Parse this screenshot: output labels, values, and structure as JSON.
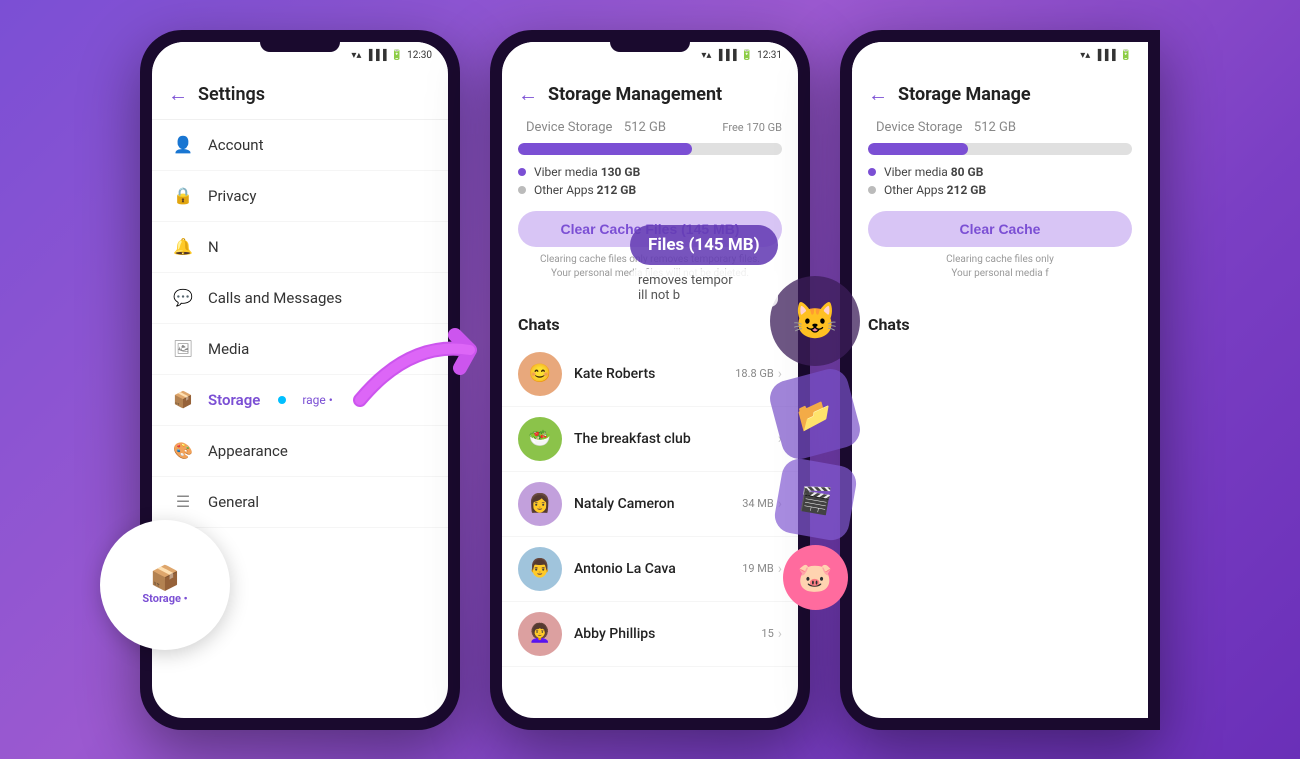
{
  "background": "#8B5CF6",
  "phone1": {
    "status_time": "12:30",
    "header": {
      "back_label": "←",
      "title": "Settings"
    },
    "menu_items": [
      {
        "icon": "👤",
        "label": "Account"
      },
      {
        "icon": "🔒",
        "label": "Privacy"
      },
      {
        "icon": "🔔",
        "label": "Notifications"
      },
      {
        "icon": "💬",
        "label": "Calls and Messages"
      },
      {
        "icon": "🖼",
        "label": "Media"
      },
      {
        "icon": "📦",
        "label": "Storage",
        "active": true,
        "dot": true
      },
      {
        "icon": "🎨",
        "label": "Appearance"
      },
      {
        "icon": "⚙",
        "label": "General"
      }
    ]
  },
  "phone2": {
    "status_time": "12:31",
    "header": {
      "back_label": "←",
      "title": "Storage Management"
    },
    "device_storage": {
      "label": "Device Storage",
      "total": "512 GB",
      "free_label": "Free",
      "free": "170 GB",
      "fill_percent": 66
    },
    "legend": [
      {
        "color": "purple",
        "label": "Viber media",
        "value": "130 GB"
      },
      {
        "color": "gray",
        "label": "Other Apps",
        "value": "212 GB"
      }
    ],
    "clear_cache_btn": "Clear Cache Files (145 MB)",
    "cache_note_line1": "Clearing cache files only removes temporary files.",
    "cache_note_line2": "Your personal media files will not be deleted.",
    "chats_header": "Chats",
    "chats": [
      {
        "name": "Kate Roberts",
        "size": "18.8 GB",
        "avatar_color": "#E8A87C",
        "emoji": "😊"
      },
      {
        "name": "The breakfast club",
        "size": "",
        "avatar_color": "#8BC34A",
        "emoji": "🥗"
      },
      {
        "name": "Nataly Cameron",
        "size": "34 MB",
        "avatar_color": "#C2A0DC",
        "emoji": "👩"
      },
      {
        "name": "Antonio La Cava",
        "size": "19 MB",
        "avatar_color": "#A0C4DC",
        "emoji": "👨"
      },
      {
        "name": "Abby Phillips",
        "size": "15",
        "avatar_color": "#DCA0A0",
        "emoji": "👩‍🦱"
      }
    ]
  },
  "overlay_bubble": "Files (145 MB)",
  "overlay_subtext": "removes tempor",
  "overlay_subtext2": "ill not b",
  "phone3": {
    "header": {
      "back_label": "←",
      "title": "Storage Manage"
    },
    "device_storage": {
      "label": "Device Storage",
      "total": "512 GB",
      "fill_percent": 38
    },
    "legend": [
      {
        "color": "purple",
        "label": "Viber media",
        "value": "80 GB"
      },
      {
        "color": "gray",
        "label": "Other Apps",
        "value": "212 GB"
      }
    ],
    "clear_cache_btn": "Clear Cache",
    "cache_note": "Clearing cache files only",
    "cache_note2": "Your personal media f",
    "chats_header": "Chats"
  }
}
